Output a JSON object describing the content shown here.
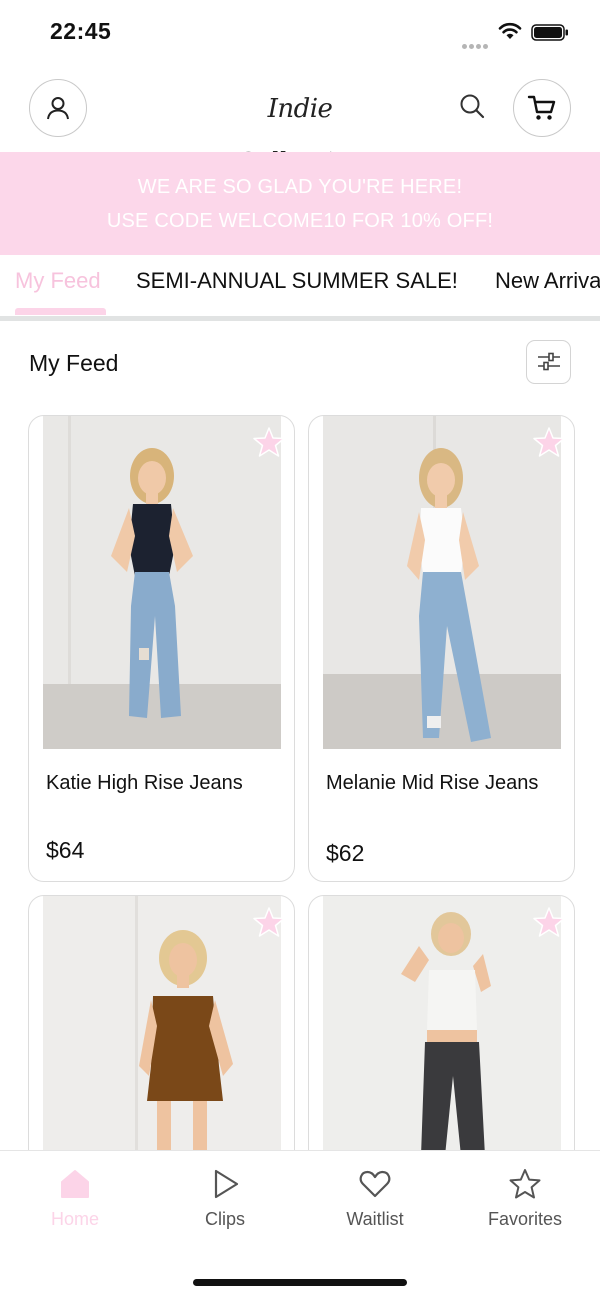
{
  "status_bar": {
    "time": "22:45"
  },
  "header": {
    "logo_text": "Indie Collection",
    "profile_icon": "user-icon",
    "search_icon": "search-icon",
    "cart_icon": "cart-icon"
  },
  "promo": {
    "line1": "WE ARE SO GLAD YOU'RE HERE!",
    "line2": "USE CODE WELCOME10 FOR 10% OFF!"
  },
  "tabs": [
    {
      "label": "My Feed",
      "active": true
    },
    {
      "label": "SEMI-ANNUAL SUMMER SALE!",
      "active": false
    },
    {
      "label": "New Arrivals",
      "active": false
    }
  ],
  "feed": {
    "title": "My Feed",
    "filter_icon": "sliders-icon"
  },
  "products": [
    {
      "name": "Katie High Rise Jeans",
      "price": "$64",
      "top": "black",
      "bottom": "light-wash jeans"
    },
    {
      "name": "Melanie Mid Rise Jeans",
      "price": "$62",
      "top": "white",
      "bottom": "light-wash jeans"
    },
    {
      "name": "",
      "price": "",
      "top": "brown romper",
      "bottom": ""
    },
    {
      "name": "",
      "price": "",
      "top": "white tank",
      "bottom": "black cargo jeans"
    }
  ],
  "bottom_nav": [
    {
      "label": "Home",
      "icon": "home-icon",
      "active": true
    },
    {
      "label": "Clips",
      "icon": "play-icon",
      "active": false
    },
    {
      "label": "Waitlist",
      "icon": "heart-icon",
      "active": false
    },
    {
      "label": "Favorites",
      "icon": "star-icon",
      "active": false
    }
  ],
  "colors": {
    "accent_pink": "#fcd4e8",
    "banner_pink": "#fcd7ea"
  }
}
